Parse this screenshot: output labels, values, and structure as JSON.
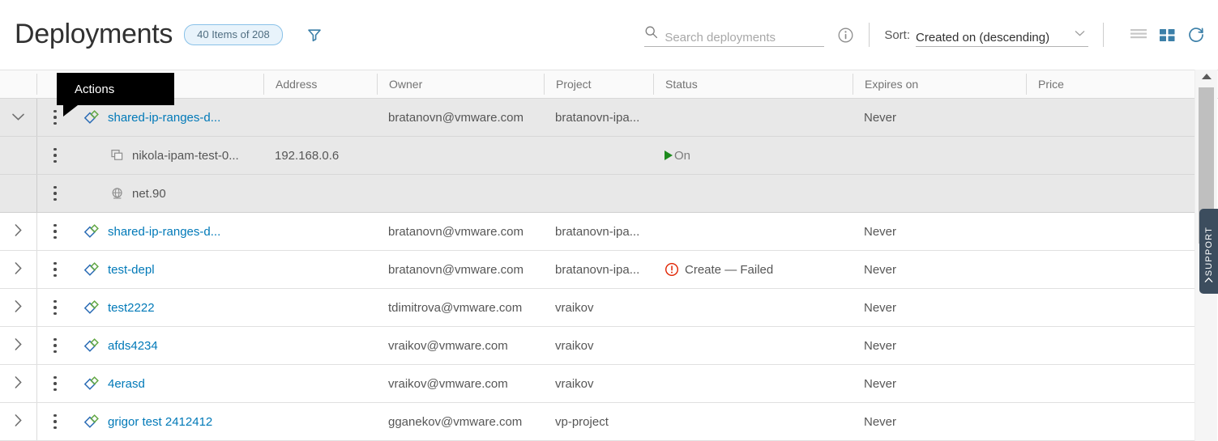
{
  "header": {
    "title": "Deployments",
    "count_badge": "40 Items of 208",
    "filter_icon": "filter-funnel-icon",
    "search": {
      "placeholder": "Search deployments",
      "value": "",
      "icon": "search-icon",
      "info_icon": "info-circle-icon"
    },
    "sort": {
      "label": "Sort:",
      "value": "Created on (descending)",
      "caret_icon": "chevron-down-icon"
    },
    "views": {
      "list_icon": "list-view-icon",
      "grid_icon": "grid-view-icon",
      "refresh_icon": "refresh-icon"
    }
  },
  "tooltip": {
    "text": "Actions"
  },
  "columns": [
    {
      "key": "expand",
      "label": ""
    },
    {
      "key": "actions",
      "label": ""
    },
    {
      "key": "name",
      "label": ""
    },
    {
      "key": "address",
      "label": "Address"
    },
    {
      "key": "owner",
      "label": "Owner"
    },
    {
      "key": "project",
      "label": "Project"
    },
    {
      "key": "status",
      "label": "Status"
    },
    {
      "key": "expires",
      "label": "Expires on"
    },
    {
      "key": "price",
      "label": "Price"
    }
  ],
  "rows": [
    {
      "expanded": true,
      "chevron": "chevron-down-icon",
      "icon": "deployment-icon",
      "name": "shared-ip-ranges-d...",
      "address": "",
      "owner": "bratanovn@vmware.com",
      "project": "bratanovn-ipa...",
      "status": "",
      "status_type": "none",
      "expires": "Never",
      "price": "",
      "children": [
        {
          "icon": "machine-icon",
          "name": "nikola-ipam-test-0...",
          "address": "192.168.0.6",
          "owner": "",
          "project": "",
          "status": "On",
          "status_type": "on",
          "expires": "",
          "price": ""
        },
        {
          "icon": "network-icon",
          "name": "net.90",
          "address": "",
          "owner": "",
          "project": "",
          "status": "",
          "status_type": "none",
          "expires": "",
          "price": ""
        }
      ]
    },
    {
      "expanded": false,
      "chevron": "chevron-right-icon",
      "icon": "deployment-icon",
      "name": "shared-ip-ranges-d...",
      "address": "",
      "owner": "bratanovn@vmware.com",
      "project": "bratanovn-ipa...",
      "status": "",
      "status_type": "none",
      "expires": "Never",
      "price": "",
      "children": []
    },
    {
      "expanded": false,
      "chevron": "chevron-right-icon",
      "icon": "deployment-icon",
      "name": "test-depl",
      "address": "",
      "owner": "bratanovn@vmware.com",
      "project": "bratanovn-ipa...",
      "status": "Create — Failed",
      "status_type": "failed",
      "expires": "Never",
      "price": "",
      "children": []
    },
    {
      "expanded": false,
      "chevron": "chevron-right-icon",
      "icon": "deployment-icon",
      "name": "test2222",
      "address": "",
      "owner": "tdimitrova@vmware.com",
      "project": "vraikov",
      "status": "",
      "status_type": "none",
      "expires": "Never",
      "price": "",
      "children": []
    },
    {
      "expanded": false,
      "chevron": "chevron-right-icon",
      "icon": "deployment-icon",
      "name": "afds4234",
      "address": "",
      "owner": "vraikov@vmware.com",
      "project": "vraikov",
      "status": "",
      "status_type": "none",
      "expires": "Never",
      "price": "",
      "children": []
    },
    {
      "expanded": false,
      "chevron": "chevron-right-icon",
      "icon": "deployment-icon",
      "name": "4erasd",
      "address": "",
      "owner": "vraikov@vmware.com",
      "project": "vraikov",
      "status": "",
      "status_type": "none",
      "expires": "Never",
      "price": "",
      "children": []
    },
    {
      "expanded": false,
      "chevron": "chevron-right-icon",
      "icon": "deployment-icon",
      "name": "grigor test 2412412",
      "address": "",
      "owner": "gganekov@vmware.com",
      "project": "vp-project",
      "status": "",
      "status_type": "none",
      "expires": "Never",
      "price": "",
      "children": []
    }
  ],
  "support_tab": {
    "label": "SUPPORT",
    "chevron": "chevron-up-icon"
  },
  "colors": {
    "link": "#0079b8",
    "accent": "#0079b8",
    "badge_border": "#89c1e8",
    "badge_bg": "#e8f3fb",
    "status_on": "#1d8a1d",
    "status_failed": "#e02200",
    "support_bg": "#3c4d5e",
    "row_selected_bg": "#e8e8e8"
  }
}
